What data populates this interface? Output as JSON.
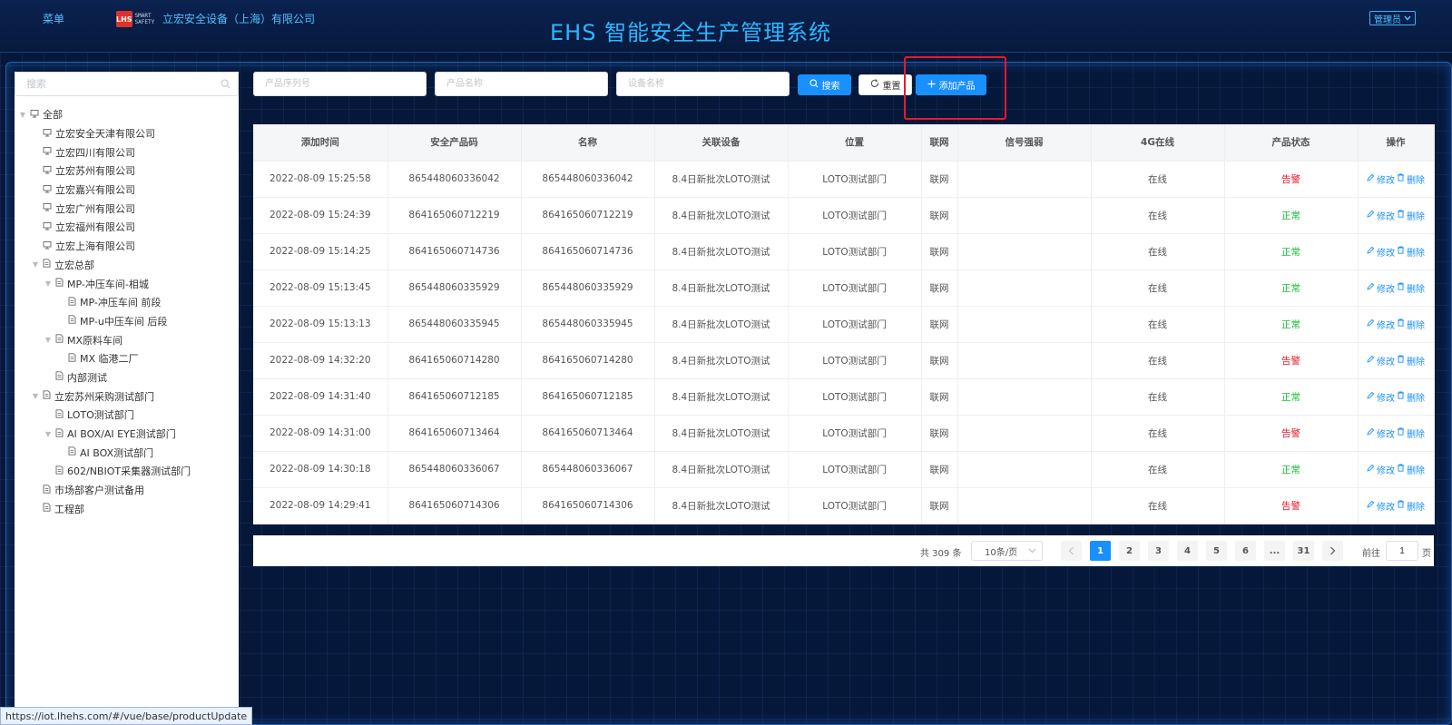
{
  "header": {
    "menu_label": "菜单",
    "logo_mark": "LHS",
    "logo_text": "SMART SAFETY",
    "company": "立宏安全设备（上海）有限公司",
    "title": "EHS 智能安全生产管理系统",
    "admin_label": "管理员"
  },
  "sidebar": {
    "search_placeholder": "搜索",
    "tree": [
      {
        "label": "全部",
        "depth": 0,
        "expand": "open",
        "icon": "monitor-icon"
      },
      {
        "label": "立宏安全天津有限公司",
        "depth": 1,
        "expand": "none",
        "icon": "monitor-icon"
      },
      {
        "label": "立宏四川有限公司",
        "depth": 1,
        "expand": "none",
        "icon": "monitor-icon"
      },
      {
        "label": "立宏苏州有限公司",
        "depth": 1,
        "expand": "none",
        "icon": "monitor-icon"
      },
      {
        "label": "立宏嘉兴有限公司",
        "depth": 1,
        "expand": "none",
        "icon": "monitor-icon"
      },
      {
        "label": "立宏广州有限公司",
        "depth": 1,
        "expand": "none",
        "icon": "monitor-icon"
      },
      {
        "label": "立宏福州有限公司",
        "depth": 1,
        "expand": "none",
        "icon": "monitor-icon"
      },
      {
        "label": "立宏上海有限公司",
        "depth": 1,
        "expand": "none",
        "icon": "monitor-icon"
      },
      {
        "label": "立宏总部",
        "depth": 1,
        "expand": "open",
        "icon": "document-icon"
      },
      {
        "label": "MP-冲压车间-相城",
        "depth": 2,
        "expand": "open",
        "icon": "document-icon"
      },
      {
        "label": "MP-冲压车间 前段",
        "depth": 3,
        "expand": "none",
        "icon": "document-icon"
      },
      {
        "label": "MP-u中压车间 后段",
        "depth": 3,
        "expand": "none",
        "icon": "document-icon"
      },
      {
        "label": "MX原料车间",
        "depth": 2,
        "expand": "open",
        "icon": "document-icon"
      },
      {
        "label": "MX 临港二厂",
        "depth": 3,
        "expand": "none",
        "icon": "document-icon"
      },
      {
        "label": "内部测试",
        "depth": 2,
        "expand": "none",
        "icon": "document-icon"
      },
      {
        "label": "立宏苏州采购测试部门",
        "depth": 1,
        "expand": "open",
        "icon": "document-icon"
      },
      {
        "label": "LOTO测试部门",
        "depth": 2,
        "expand": "none",
        "icon": "document-icon"
      },
      {
        "label": "AI BOX/AI EYE测试部门",
        "depth": 2,
        "expand": "open",
        "icon": "document-icon"
      },
      {
        "label": "AI BOX测试部门",
        "depth": 3,
        "expand": "none",
        "icon": "document-icon"
      },
      {
        "label": "602/NBIOT采集器测试部门",
        "depth": 2,
        "expand": "none",
        "icon": "document-icon"
      },
      {
        "label": "市场部客户测试备用",
        "depth": 1,
        "expand": "none",
        "icon": "document-icon"
      },
      {
        "label": "工程部",
        "depth": 1,
        "expand": "none",
        "icon": "document-icon"
      }
    ]
  },
  "toolbar": {
    "serial_placeholder": "产品序列号",
    "name_placeholder": "产品名称",
    "device_placeholder": "设备名称",
    "search_label": "搜索",
    "reset_label": "重置",
    "add_label": "添加产品"
  },
  "table": {
    "headers": [
      "添加时间",
      "安全产品码",
      "名称",
      "关联设备",
      "位置",
      "联网",
      "信号强弱",
      "4G在线",
      "产品状态",
      "操作"
    ],
    "edit_label": "修改",
    "delete_label": "删除",
    "rows": [
      {
        "time": "2022-08-09 15:25:58",
        "code": "865448060336042",
        "name": "865448060336042",
        "device": "8.4日新批次LOTO测试",
        "location": "LOTO测试部门",
        "net": "联网",
        "signal": "",
        "online": "在线",
        "status": "告警",
        "status_type": "warn"
      },
      {
        "time": "2022-08-09 15:24:39",
        "code": "864165060712219",
        "name": "864165060712219",
        "device": "8.4日新批次LOTO测试",
        "location": "LOTO测试部门",
        "net": "联网",
        "signal": "",
        "online": "在线",
        "status": "正常",
        "status_type": "ok"
      },
      {
        "time": "2022-08-09 15:14:25",
        "code": "864165060714736",
        "name": "864165060714736",
        "device": "8.4日新批次LOTO测试",
        "location": "LOTO测试部门",
        "net": "联网",
        "signal": "",
        "online": "在线",
        "status": "正常",
        "status_type": "ok"
      },
      {
        "time": "2022-08-09 15:13:45",
        "code": "865448060335929",
        "name": "865448060335929",
        "device": "8.4日新批次LOTO测试",
        "location": "LOTO测试部门",
        "net": "联网",
        "signal": "",
        "online": "在线",
        "status": "正常",
        "status_type": "ok"
      },
      {
        "time": "2022-08-09 15:13:13",
        "code": "865448060335945",
        "name": "865448060335945",
        "device": "8.4日新批次LOTO测试",
        "location": "LOTO测试部门",
        "net": "联网",
        "signal": "",
        "online": "在线",
        "status": "正常",
        "status_type": "ok"
      },
      {
        "time": "2022-08-09 14:32:20",
        "code": "864165060714280",
        "name": "864165060714280",
        "device": "8.4日新批次LOTO测试",
        "location": "LOTO测试部门",
        "net": "联网",
        "signal": "",
        "online": "在线",
        "status": "告警",
        "status_type": "warn"
      },
      {
        "time": "2022-08-09 14:31:40",
        "code": "864165060712185",
        "name": "864165060712185",
        "device": "8.4日新批次LOTO测试",
        "location": "LOTO测试部门",
        "net": "联网",
        "signal": "",
        "online": "在线",
        "status": "正常",
        "status_type": "ok"
      },
      {
        "time": "2022-08-09 14:31:00",
        "code": "864165060713464",
        "name": "864165060713464",
        "device": "8.4日新批次LOTO测试",
        "location": "LOTO测试部门",
        "net": "联网",
        "signal": "",
        "online": "在线",
        "status": "告警",
        "status_type": "warn"
      },
      {
        "time": "2022-08-09 14:30:18",
        "code": "865448060336067",
        "name": "865448060336067",
        "device": "8.4日新批次LOTO测试",
        "location": "LOTO测试部门",
        "net": "联网",
        "signal": "",
        "online": "在线",
        "status": "正常",
        "status_type": "ok"
      },
      {
        "time": "2022-08-09 14:29:41",
        "code": "864165060714306",
        "name": "864165060714306",
        "device": "8.4日新批次LOTO测试",
        "location": "LOTO测试部门",
        "net": "联网",
        "signal": "",
        "online": "在线",
        "status": "告警",
        "status_type": "warn"
      }
    ]
  },
  "pagination": {
    "total_text": "共 309 条",
    "page_size": "10条/页",
    "pages": [
      "1",
      "2",
      "3",
      "4",
      "5",
      "6",
      "...",
      "31"
    ],
    "current_page": "1",
    "goto_label": "前往",
    "goto_value": "1",
    "page_unit": "页"
  },
  "status_url": "https://iot.lhehs.com/#/vue/base/productUpdate",
  "colors": {
    "accent": "#1890ff",
    "warn": "#e8192c",
    "ok": "#19be3b",
    "title": "#2fb5ff",
    "highlight": "#e8192c"
  }
}
